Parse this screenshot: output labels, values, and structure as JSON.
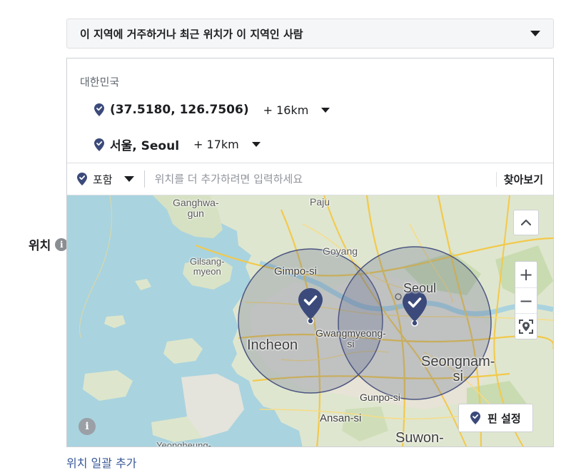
{
  "field_label": "위치",
  "audience_dropdown": {
    "value": "이 지역에 거주하거나 최근 위치가 이 지역인 사람"
  },
  "country": "대한민국",
  "locations": [
    {
      "name": "(37.5180, 126.7506)",
      "radius": "+ 16km"
    },
    {
      "name": "서울, Seoul",
      "radius": "+ 17km"
    }
  ],
  "search": {
    "include_label": "포함",
    "placeholder": "위치를 더 추가하려면 입력하세요",
    "browse_label": "찾아보기"
  },
  "map": {
    "labels": {
      "ganghwa": "Ganghwa-\ngun",
      "paju": "Paju",
      "goyang": "Goyang",
      "gilsang": "Gilsang-\nmyeon",
      "gimpo": "Gimpo-si",
      "seoul": "Seoul",
      "incheon": "Incheon",
      "gwangmyeong": "Gwangmyeong-\nsi",
      "seongnam": "Seongnam-\nsi",
      "gunpo": "Gunpo-si",
      "ansan": "Ansan-si",
      "suwon": "Suwon-",
      "yeongheung": "Yeongheung-"
    },
    "drop_pin_label": "핀 설정",
    "zoom_in": "+",
    "zoom_out": "−",
    "pin_color": "#3b4a7a",
    "circle_fill": "rgba(95,105,140,0.28)"
  },
  "bulk_add_link": "위치 일괄 추가",
  "colors": {
    "link": "#385898",
    "pin": "#3b4a7a"
  }
}
